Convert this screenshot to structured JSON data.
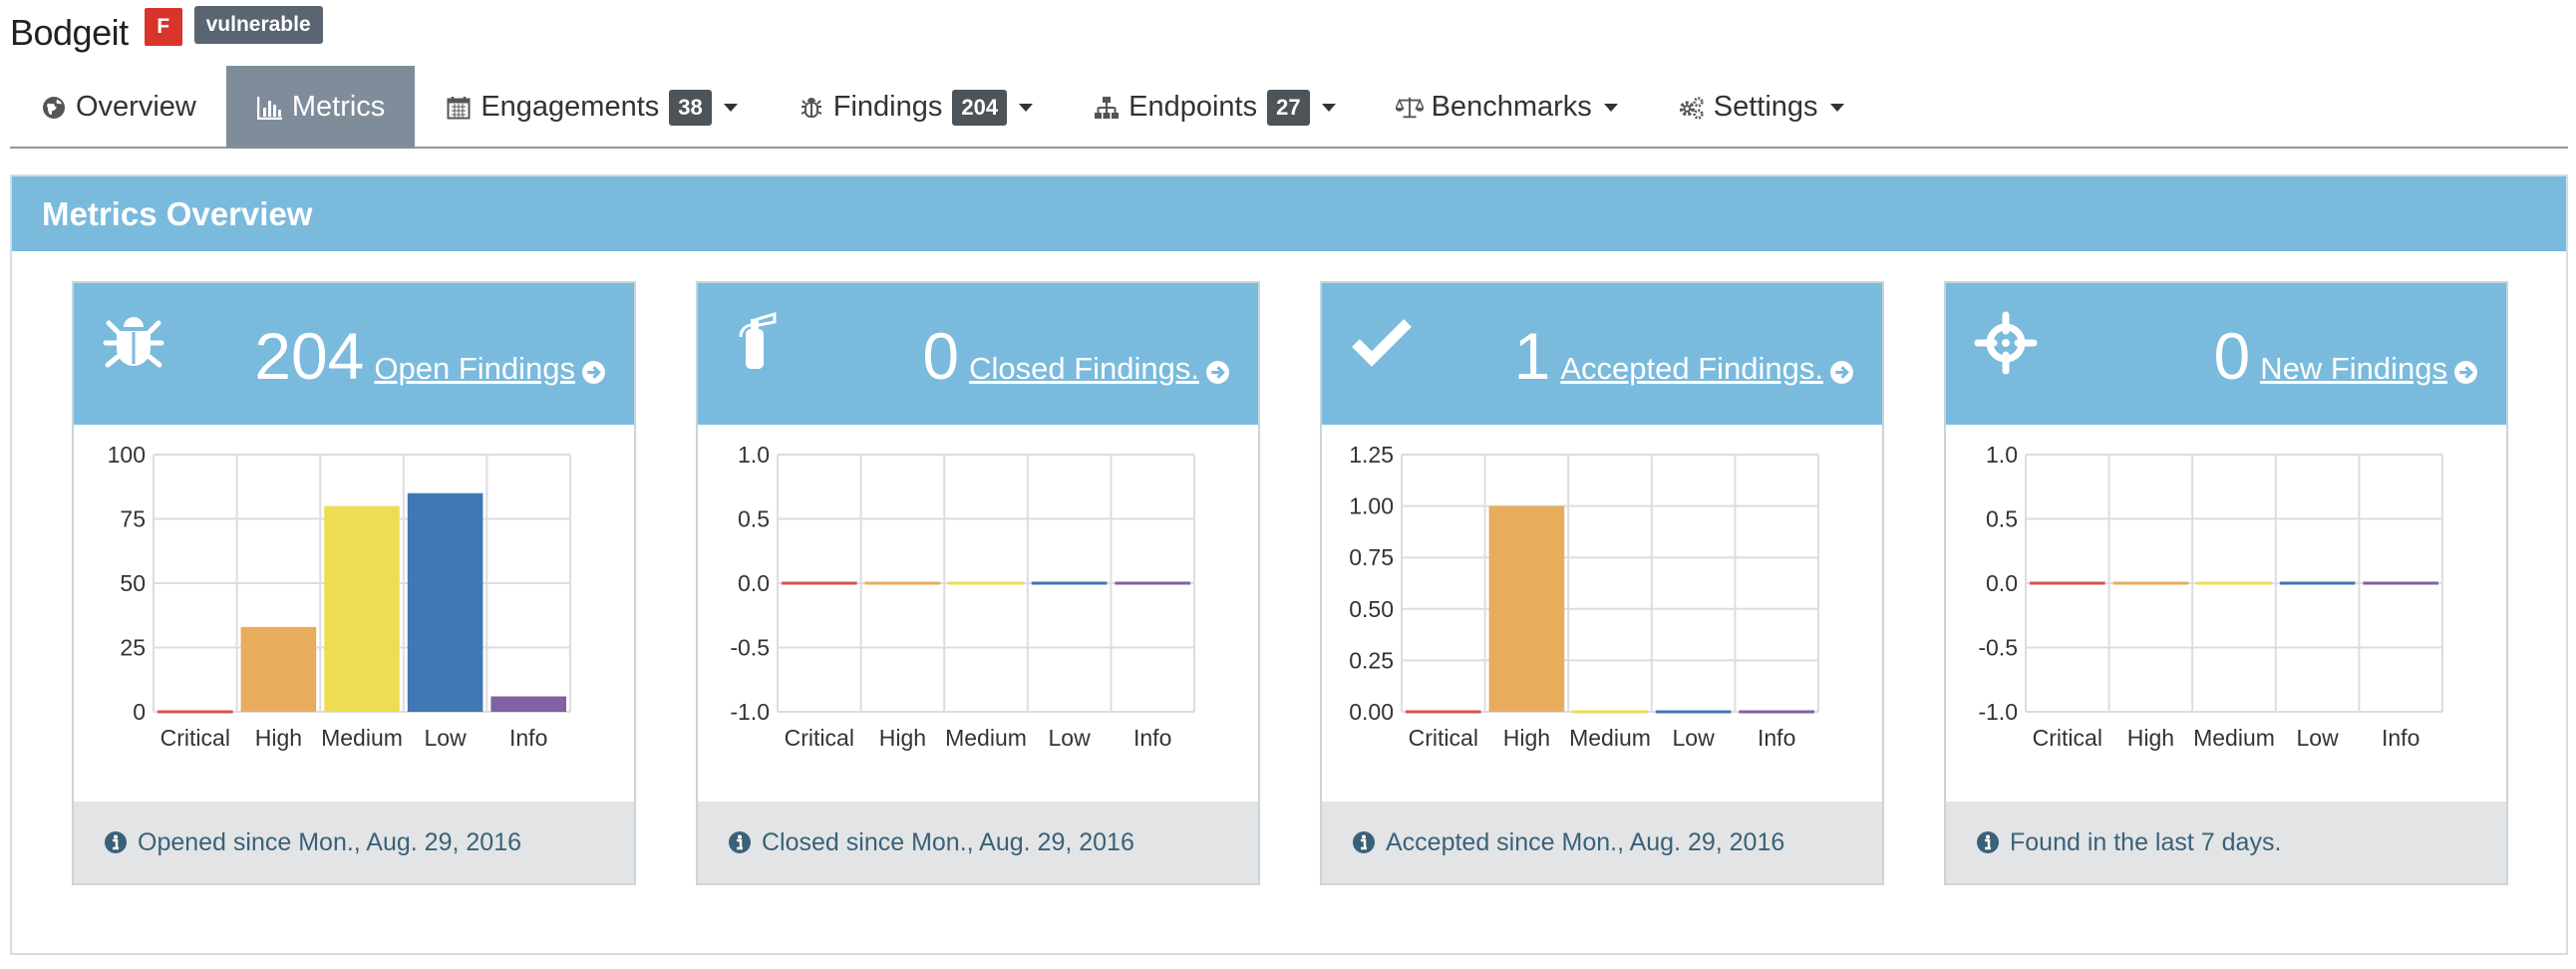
{
  "product": {
    "name": "Bodgeit",
    "grade": "F",
    "tag": "vulnerable"
  },
  "nav": [
    {
      "label": "Overview",
      "icon": "globe-icon",
      "count": null,
      "dropdown": false,
      "active": false
    },
    {
      "label": "Metrics",
      "icon": "bar-chart-icon",
      "count": null,
      "dropdown": false,
      "active": true
    },
    {
      "label": "Engagements",
      "icon": "calendar-icon",
      "count": "38",
      "dropdown": true,
      "active": false
    },
    {
      "label": "Findings",
      "icon": "bug-icon",
      "count": "204",
      "dropdown": true,
      "active": false
    },
    {
      "label": "Endpoints",
      "icon": "sitemap-icon",
      "count": "27",
      "dropdown": true,
      "active": false
    },
    {
      "label": "Benchmarks",
      "icon": "balance-scale-icon",
      "count": null,
      "dropdown": true,
      "active": false
    },
    {
      "label": "Settings",
      "icon": "gears-icon",
      "count": null,
      "dropdown": true,
      "active": false
    }
  ],
  "panel": {
    "title": "Metrics Overview"
  },
  "colors": {
    "accent": "#7abadd",
    "nav_active": "#7f8d9b",
    "critical": "#d9534f",
    "high": "#e8ac5d",
    "medium": "#eedd54",
    "low": "#4177b4",
    "info": "#7f62a1"
  },
  "cards": [
    {
      "icon": "bug-icon",
      "count": "204",
      "link": "Open Findings ",
      "footer": "Opened since Mon., Aug. 29, 2016"
    },
    {
      "icon": "fire-extinguisher-icon",
      "count": "0",
      "link": "Closed Findings. ",
      "footer": "Closed since Mon., Aug. 29, 2016"
    },
    {
      "icon": "check-icon",
      "count": "1",
      "link": "Accepted Findings. ",
      "footer": "Accepted since Mon., Aug. 29, 2016"
    },
    {
      "icon": "crosshairs-icon",
      "count": "0",
      "link": "New Findings ",
      "footer": "Found in the last 7 days."
    }
  ],
  "chart_data": [
    {
      "type": "bar",
      "categories": [
        "Critical",
        "High",
        "Medium",
        "Low",
        "Info"
      ],
      "values": [
        0,
        33,
        80,
        85,
        6
      ],
      "ylim": [
        0,
        100
      ],
      "yticks": [
        "100",
        "75",
        "50",
        "25",
        "0"
      ],
      "grid": true
    },
    {
      "type": "bar",
      "categories": [
        "Critical",
        "High",
        "Medium",
        "Low",
        "Info"
      ],
      "values": [
        0,
        0,
        0,
        0,
        0
      ],
      "ylim": [
        -1,
        1
      ],
      "yticks": [
        "1.0",
        "0.5",
        "0.0",
        "-0.5",
        "-1.0"
      ],
      "grid": true
    },
    {
      "type": "bar",
      "categories": [
        "Critical",
        "High",
        "Medium",
        "Low",
        "Info"
      ],
      "values": [
        0,
        1,
        0,
        0,
        0
      ],
      "ylim": [
        0,
        1.25
      ],
      "yticks": [
        "1.25",
        "1.00",
        "0.75",
        "0.50",
        "0.25",
        "0.00"
      ],
      "grid": true
    },
    {
      "type": "bar",
      "categories": [
        "Critical",
        "High",
        "Medium",
        "Low",
        "Info"
      ],
      "values": [
        0,
        0,
        0,
        0,
        0
      ],
      "ylim": [
        -1,
        1
      ],
      "yticks": [
        "1.0",
        "0.5",
        "0.0",
        "-0.5",
        "-1.0"
      ],
      "grid": true
    }
  ]
}
